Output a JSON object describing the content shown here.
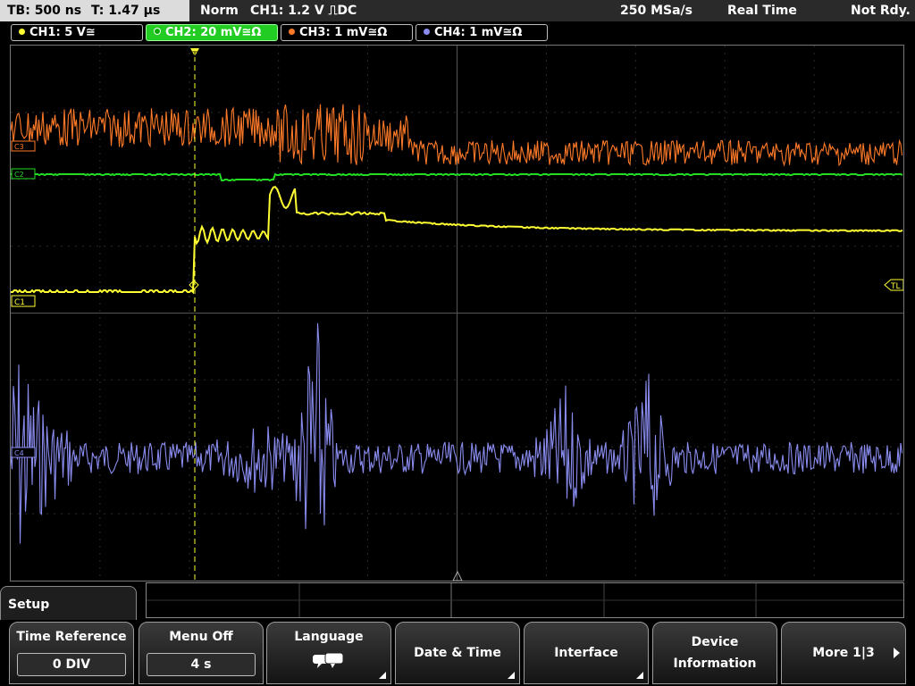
{
  "header": {
    "timebase": "TB: 500 ns",
    "trigger_time": "T: 1.47 µs",
    "mode": "Norm",
    "trigger_info": "CH1: 1.2 V ⎍DC",
    "sample_rate": "250 MSa/s",
    "acq_mode": "Real Time",
    "status": "Not Rdy."
  },
  "channels": [
    {
      "label": "CH1: 5 V≅",
      "color": "#ffff33",
      "active": false
    },
    {
      "label": "CH2: 20 mV≅Ω",
      "color": "#22dd22",
      "active": true
    },
    {
      "label": "CH3: 1 mV≅Ω",
      "color": "#ff7a28",
      "active": false
    },
    {
      "label": "CH4: 1 mV≅Ω",
      "color": "#8a8cf0",
      "active": false
    }
  ],
  "markers": {
    "c1": "C1",
    "c2": "C2",
    "c3": "C3",
    "c4": "C4",
    "trigger_level": "TL",
    "trigger_marker": "T"
  },
  "menu": {
    "title": "Setup",
    "keys": [
      {
        "label": "Time Reference",
        "value": "0 DIV"
      },
      {
        "label": "Menu Off",
        "value": "4 s"
      },
      {
        "label": "Language",
        "icon": "speech-bubbles-icon"
      },
      {
        "label": "Date & Time"
      },
      {
        "label": "Interface"
      },
      {
        "label": "Device Information"
      },
      {
        "label": "More 1|3"
      }
    ]
  }
}
